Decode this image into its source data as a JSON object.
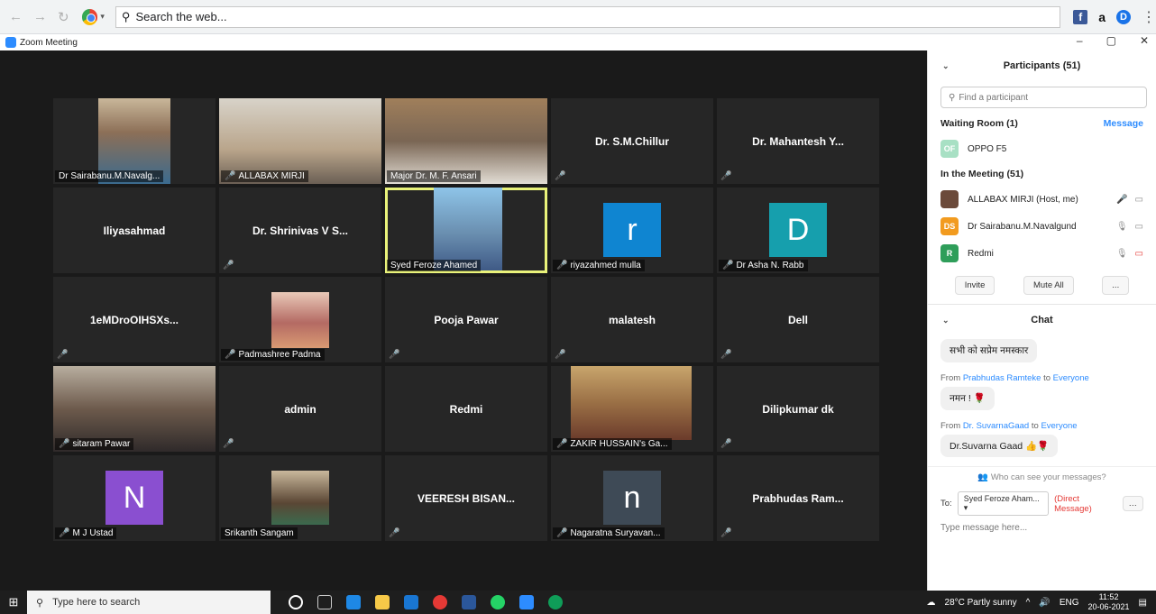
{
  "browser": {
    "search_placeholder": "Search the web...",
    "nav_icons": [
      "back-icon",
      "forward-icon",
      "refresh-icon"
    ],
    "fb_label": "f",
    "amz_label": "a",
    "ext_label": "D",
    "kebab": "⋮"
  },
  "zoom_window": {
    "title": "Zoom Meeting",
    "controls": [
      "–",
      "▢",
      "✕"
    ]
  },
  "tiles": [
    {
      "name": "Dr Sairabanu.M.Navalg...",
      "type": "photo",
      "photo": "ph-1",
      "muted": false
    },
    {
      "name": "ALLABAX MIRJI",
      "type": "photo",
      "photo": "ph-2",
      "muted": true
    },
    {
      "name": "Major  Dr. M. F. Ansari",
      "type": "photo",
      "photo": "ph-3",
      "muted": false
    },
    {
      "name": "Dr. S.M.Chillur",
      "type": "name",
      "muted": true
    },
    {
      "name": "Dr. Mahantesh Y...",
      "type": "name",
      "muted": true
    },
    {
      "name": "Iliyasahmad",
      "type": "name",
      "muted": false
    },
    {
      "name": "Dr. Shrinivas V S...",
      "type": "name",
      "muted": true
    },
    {
      "name": "Syed Feroze Ahamed",
      "type": "photo",
      "photo": "ph-4",
      "muted": false,
      "active": true
    },
    {
      "name": "riyazahmed mulla",
      "type": "letter",
      "letter": "r",
      "color": "#0f85d1",
      "muted": true
    },
    {
      "name": "Dr Asha N. Rabb",
      "type": "letter",
      "letter": "D",
      "color": "#169fad",
      "muted": true
    },
    {
      "name": "1eMDroOIHSXs...",
      "type": "name",
      "muted": true
    },
    {
      "name": "Padmashree Padma",
      "type": "photo",
      "photo": "ph-5",
      "muted": true
    },
    {
      "name": "Pooja Pawar",
      "type": "name",
      "muted": true
    },
    {
      "name": "malatesh",
      "type": "name",
      "muted": true
    },
    {
      "name": "Dell",
      "type": "name",
      "muted": true
    },
    {
      "name": "sitaram Pawar",
      "type": "photo",
      "photo": "ph-6",
      "muted": true
    },
    {
      "name": "admin",
      "type": "name",
      "muted": true
    },
    {
      "name": "Redmi",
      "type": "name",
      "muted": false
    },
    {
      "name": "ZAKIR HUSSAIN's Ga...",
      "type": "photo",
      "photo": "ph-7",
      "muted": true
    },
    {
      "name": "Dilipkumar dk",
      "type": "name",
      "muted": true
    },
    {
      "name": "M J Ustad",
      "type": "letter",
      "letter": "N",
      "color": "#8a4fd0",
      "muted": true
    },
    {
      "name": "Srikanth Sangam",
      "type": "photo",
      "photo": "ph-8",
      "muted": false
    },
    {
      "name": "VEERESH  BISAN...",
      "type": "name",
      "muted": true
    },
    {
      "name": "Nagaratna Suryavan...",
      "type": "letter",
      "letter": "n",
      "color": "#3e4a56",
      "muted": true
    },
    {
      "name": "Prabhudas Ram...",
      "type": "name",
      "muted": true
    }
  ],
  "participants": {
    "header": "Participants (51)",
    "find_placeholder": "Find a participant",
    "waiting_room": "Waiting Room (1)",
    "message_link": "Message",
    "waiting": [
      {
        "initials": "OF",
        "name": "OPPO F5",
        "color": "#a8e0c4"
      }
    ],
    "in_meeting": "In the Meeting (51)",
    "members": [
      {
        "initials": "",
        "name": "ALLABAX MIRJI (Host, me)",
        "color": "#6b4a3a"
      },
      {
        "initials": "DS",
        "name": "Dr Sairabanu.M.Navalgund",
        "color": "#f29b1f"
      },
      {
        "initials": "R",
        "name": "Redmi",
        "color": "#2f9e5a"
      }
    ],
    "invite": "Invite",
    "mute_all": "Mute All",
    "more": "..."
  },
  "chat": {
    "header": "Chat",
    "messages": [
      {
        "from": "",
        "text": "सभी को सप्रेम नमस्कार"
      },
      {
        "from": "Prabhudas Ramteke",
        "to": "Everyone",
        "text": "नमन ! 🌹"
      },
      {
        "from": "Dr. SuvarnaGaad",
        "to": "Everyone",
        "text": "Dr.Suvarna Gaad 👍🌹"
      }
    ],
    "from_prefix": "From",
    "to_word": "to",
    "who_can_see": "Who can see your messages?",
    "to_label": "To:",
    "to_value": "Syed Feroze Aham...",
    "direct": "(Direct Message)",
    "input_placeholder": "Type message here..."
  },
  "taskbar": {
    "search": "Type here to search",
    "weather": "28°C  Partly sunny",
    "lang": "ENG",
    "time": "11:52",
    "date": "20-06-2021"
  }
}
